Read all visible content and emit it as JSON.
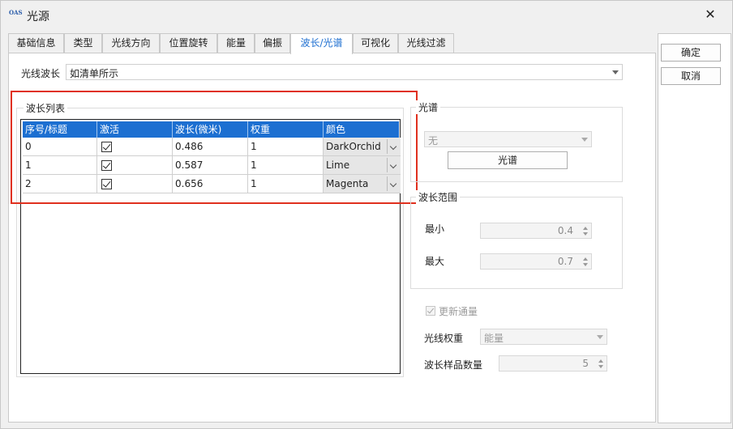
{
  "window": {
    "title": "光源",
    "logo_text": "OAS"
  },
  "tabs": [
    {
      "label": "基础信息",
      "active": false
    },
    {
      "label": "类型",
      "active": false
    },
    {
      "label": "光线方向",
      "active": false
    },
    {
      "label": "位置旋转",
      "active": false
    },
    {
      "label": "能量",
      "active": false
    },
    {
      "label": "偏振",
      "active": false
    },
    {
      "label": "波长/光谱",
      "active": true
    },
    {
      "label": "可视化",
      "active": false
    },
    {
      "label": "光线过滤",
      "active": false
    }
  ],
  "ray_wavelength": {
    "label": "光线波长",
    "value": "如清单所示"
  },
  "wavelength_list": {
    "title": "波长列表",
    "columns": [
      "序号/标题",
      "激活",
      "波长(微米)",
      "权重",
      "颜色"
    ],
    "rows": [
      {
        "index": "0",
        "active": true,
        "wavelength": "0.486",
        "weight": "1",
        "color": "DarkOrchid"
      },
      {
        "index": "1",
        "active": true,
        "wavelength": "0.587",
        "weight": "1",
        "color": "Lime"
      },
      {
        "index": "2",
        "active": true,
        "wavelength": "0.656",
        "weight": "1",
        "color": "Magenta"
      }
    ]
  },
  "spectrum": {
    "title": "光谱",
    "select_value": "无",
    "button_label": "光谱"
  },
  "range": {
    "title": "波长范围",
    "min_label": "最小",
    "min_value": "0.4",
    "max_label": "最大",
    "max_value": "0.7"
  },
  "update_channel": {
    "label": "更新通量",
    "checked": true
  },
  "ray_weight": {
    "label": "光线权重",
    "value": "能量"
  },
  "sample_count": {
    "label": "波长样品数量",
    "value": "5"
  },
  "buttons": {
    "ok": "确定",
    "cancel": "取消"
  },
  "colors": {
    "accent": "#1c6fd1",
    "highlight": "#e0301e"
  }
}
